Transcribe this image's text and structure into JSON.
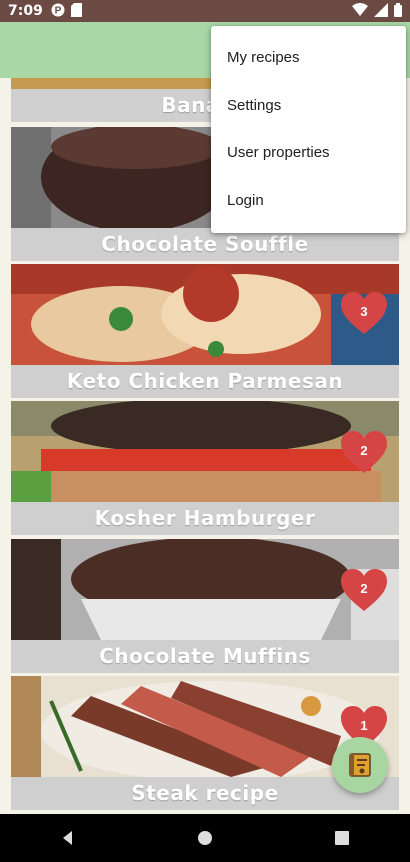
{
  "status_bar": {
    "time": "7:09",
    "left_icons": [
      "p-circle-icon",
      "sd-card-icon"
    ],
    "right_icons": [
      "wifi-icon",
      "signal-icon",
      "battery-icon"
    ]
  },
  "menu": {
    "items": [
      "My recipes",
      "Settings",
      "User properties",
      "Login"
    ]
  },
  "recipes": [
    {
      "title": "Banana",
      "likes": null
    },
    {
      "title": "Chocolate Souffle",
      "likes": null
    },
    {
      "title": "Keto Chicken Parmesan",
      "likes": "3"
    },
    {
      "title": "Kosher Hamburger",
      "likes": "2"
    },
    {
      "title": "Chocolate Muffins",
      "likes": "2"
    },
    {
      "title": "Steak recipe",
      "likes": "1"
    }
  ],
  "fab": {
    "icon": "recipe-book-icon"
  },
  "nav": {
    "icons": [
      "back-icon",
      "home-icon",
      "recents-icon"
    ]
  },
  "colors": {
    "status_bar": "#6b4a44",
    "app_bar": "#a9d8a6",
    "heart": "#d64545",
    "title_bar": "#cfcfcf",
    "fab": "#a8d6a0"
  }
}
